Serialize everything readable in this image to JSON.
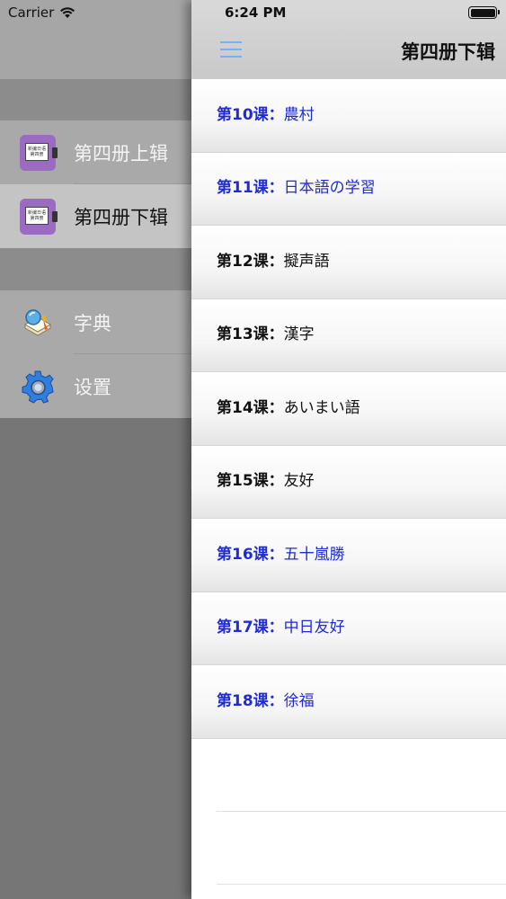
{
  "status": {
    "carrier": "Carrier",
    "time": "6:24 PM"
  },
  "drawer": {
    "books": [
      {
        "label": "第四册上辑",
        "selected": false,
        "icon": "book-cover-icon"
      },
      {
        "label": "第四册下辑",
        "selected": true,
        "icon": "book-cover-icon"
      }
    ],
    "tools": [
      {
        "label": "字典",
        "icon": "dictionary-icon"
      },
      {
        "label": "设置",
        "icon": "gear-icon"
      }
    ]
  },
  "header": {
    "title": "第四册下辑",
    "menu_icon": "hamburger-menu-icon"
  },
  "colors": {
    "unread_lesson": "#1e2bd6",
    "read_lesson": "#111111",
    "menu_accent": "#6fb3ff"
  },
  "lessons": [
    {
      "num": "第10课：",
      "title": "農村",
      "state": "unread"
    },
    {
      "num": "第11课：",
      "title": "日本語の学習",
      "state": "unread"
    },
    {
      "num": "第12课：",
      "title": "擬声語",
      "state": "read"
    },
    {
      "num": "第13课：",
      "title": "漢字",
      "state": "read"
    },
    {
      "num": "第14课：",
      "title": "あいまい語",
      "state": "read"
    },
    {
      "num": "第15课：",
      "title": "友好",
      "state": "read"
    },
    {
      "num": "第16课：",
      "title": "五十嵐勝",
      "state": "unread"
    },
    {
      "num": "第17课：",
      "title": "中日友好",
      "state": "unread"
    },
    {
      "num": "第18课：",
      "title": "徐福",
      "state": "unread"
    }
  ]
}
